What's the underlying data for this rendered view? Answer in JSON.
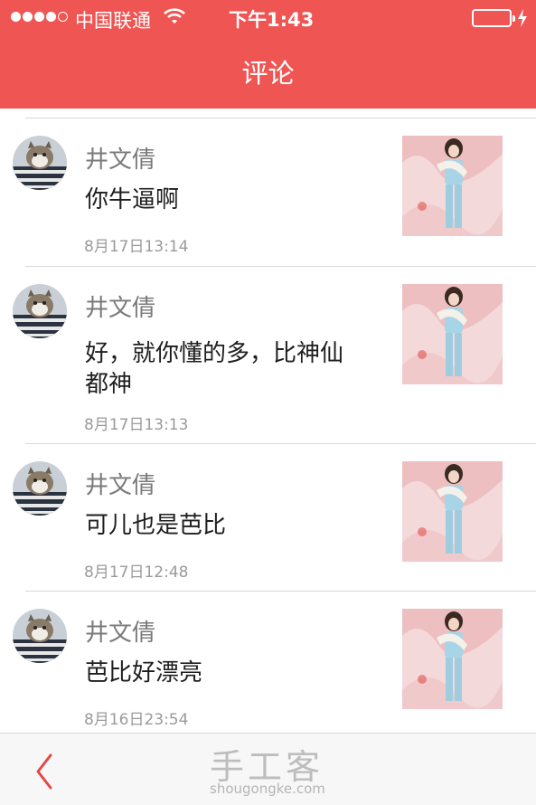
{
  "status_bar": {
    "carrier": "中国联通",
    "time": "下午1:43"
  },
  "header": {
    "title": "评论"
  },
  "comments": [
    {
      "name": "井文倩",
      "text": "你牛逼啊",
      "date": "8月17日13:14"
    },
    {
      "name": "井文倩",
      "text": "好，就你懂的多，比神仙都神",
      "date": "8月17日13:13"
    },
    {
      "name": "井文倩",
      "text": "可儿也是芭比",
      "date": "8月17日12:48"
    },
    {
      "name": "井文倩",
      "text": "芭比好漂亮",
      "date": "8月16日23:54"
    }
  ],
  "icons": {
    "back": "chevron-left-icon",
    "wifi": "wifi-icon",
    "battery": "battery-icon"
  },
  "watermark": {
    "chinese": "手工客",
    "url": "shougongke.com"
  },
  "colors": {
    "accent": "#ee5553",
    "back_arrow": "#e04a48"
  }
}
